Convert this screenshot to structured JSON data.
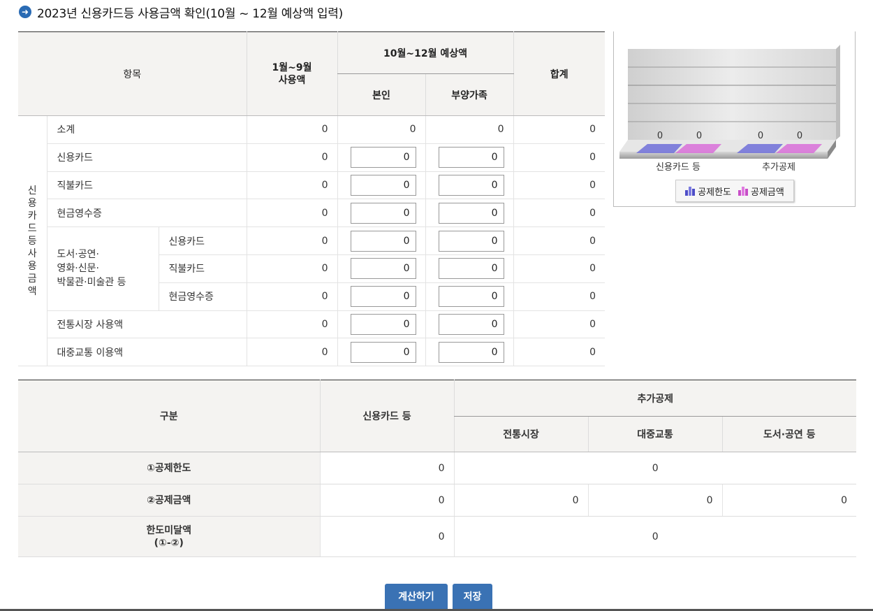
{
  "title": "2023년 신용카드등 사용금액 확인(10월 ~ 12월 예상액 입력)",
  "title_icon": "arrow-right-circle-icon",
  "usage_table": {
    "headers": {
      "item": "항목",
      "jan_sep_line1": "1월~9월",
      "jan_sep_line2": "사용액",
      "oct_dec": "10월~12월 예상액",
      "self": "본인",
      "dependents": "부양가족",
      "total": "합계"
    },
    "group_label": "신용카드등 사용금액",
    "culture_label_line1": "도서·공연·",
    "culture_label_line2": "영화·신문·",
    "culture_label_line3": "박물관·미술관 등",
    "rows": [
      {
        "label": "소계",
        "jan_sep": "0",
        "self": "0",
        "dependents": "0",
        "total": "0"
      },
      {
        "label": "신용카드",
        "jan_sep": "0",
        "self": "0",
        "dependents": "0",
        "total": "0"
      },
      {
        "label": "직불카드",
        "jan_sep": "0",
        "self": "0",
        "dependents": "0",
        "total": "0"
      },
      {
        "label": "현금영수증",
        "jan_sep": "0",
        "self": "0",
        "dependents": "0",
        "total": "0"
      },
      {
        "label": "신용카드",
        "jan_sep": "0",
        "self": "0",
        "dependents": "0",
        "total": "0"
      },
      {
        "label": "직불카드",
        "jan_sep": "0",
        "self": "0",
        "dependents": "0",
        "total": "0"
      },
      {
        "label": "현금영수증",
        "jan_sep": "0",
        "self": "0",
        "dependents": "0",
        "total": "0"
      },
      {
        "label": "전통시장 사용액",
        "jan_sep": "0",
        "self": "0",
        "dependents": "0",
        "total": "0"
      },
      {
        "label": "대중교통 이용액",
        "jan_sep": "0",
        "self": "0",
        "dependents": "0",
        "total": "0"
      }
    ]
  },
  "chart_data": {
    "type": "bar",
    "categories": [
      "신용카드 등",
      "추가공제"
    ],
    "series": [
      {
        "name": "공제한도",
        "values": [
          0,
          0
        ],
        "color": "#6f6fd8"
      },
      {
        "name": "공제금액",
        "values": [
          0,
          0
        ],
        "color": "#d86fd8"
      }
    ],
    "data_labels": [
      "0",
      "0",
      "0",
      "0"
    ],
    "legend": "bottom"
  },
  "deduction_table": {
    "headers": {
      "category": "구분",
      "credit_card": "신용카드 등",
      "additional": "추가공제",
      "market": "전통시장",
      "transit": "대중교통",
      "culture": "도서·공연 등"
    },
    "rows": {
      "limit": {
        "label": "①공제한도",
        "credit_card": "0",
        "additional": "0"
      },
      "amount": {
        "label": "②공제금액",
        "credit_card": "0",
        "market": "0",
        "transit": "0",
        "culture": "0"
      },
      "remaining": {
        "label_line1": "한도미달액",
        "label_line2": "(①-②)",
        "credit_card": "0",
        "additional": "0"
      }
    }
  },
  "buttons": {
    "calculate": "계산하기",
    "save": "저장"
  },
  "colors": {
    "button": "#3a72b4",
    "header_bg": "#f4f3f1",
    "title_icon": "#2a6bb4"
  }
}
